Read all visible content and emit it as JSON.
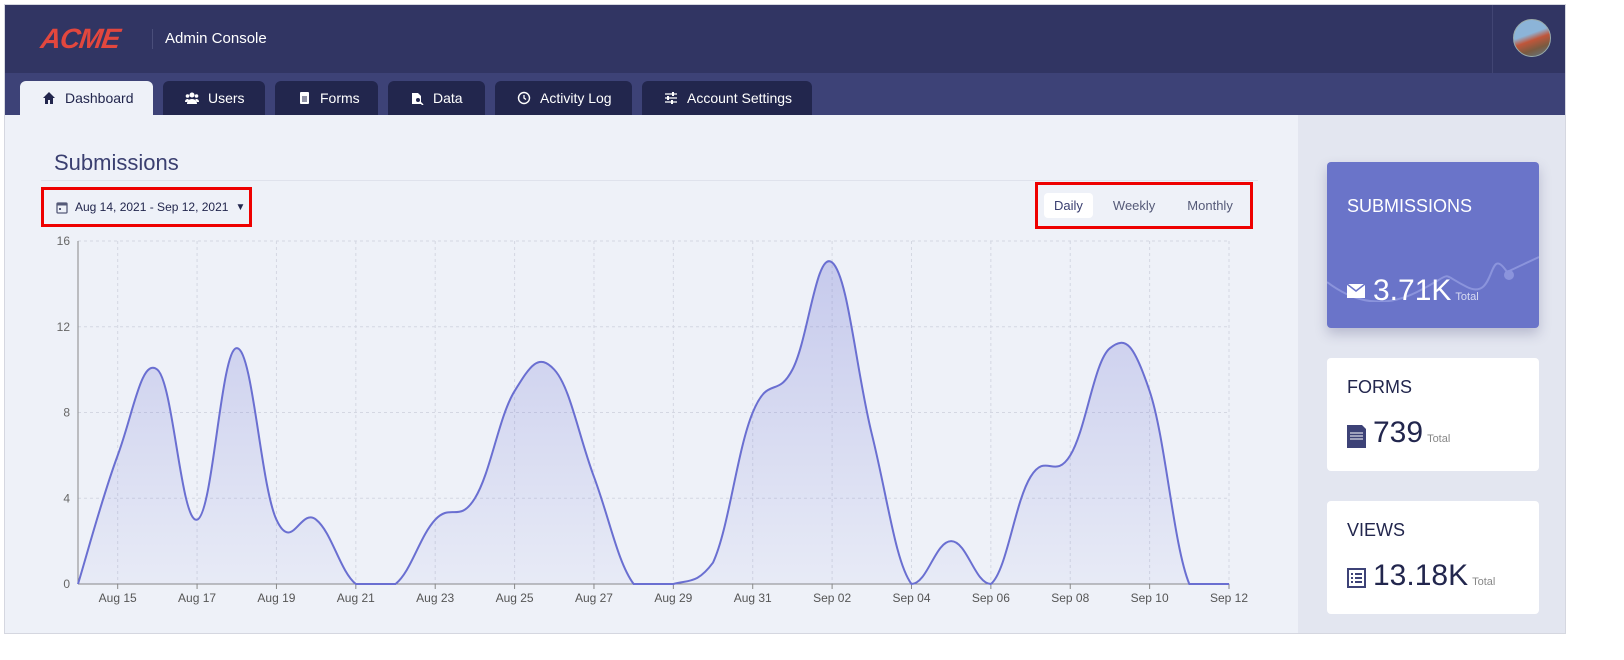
{
  "header": {
    "logo": "ACME",
    "title": "Admin Console"
  },
  "tabs": [
    {
      "label": "Dashboard",
      "icon": "home-icon"
    },
    {
      "label": "Users",
      "icon": "users-icon"
    },
    {
      "label": "Forms",
      "icon": "forms-icon"
    },
    {
      "label": "Data",
      "icon": "data-icon"
    },
    {
      "label": "Activity Log",
      "icon": "history-icon"
    },
    {
      "label": "Account Settings",
      "icon": "sliders-icon"
    }
  ],
  "main": {
    "title": "Submissions",
    "date_range": "Aug 14, 2021 - Sep 12, 2021",
    "periods": [
      "Daily",
      "Weekly",
      "Monthly"
    ],
    "selected_period": "Daily"
  },
  "cards": [
    {
      "title": "SUBMISSIONS",
      "value": "3.71K",
      "suffix": "Total",
      "icon": "envelope-icon"
    },
    {
      "title": "FORMS",
      "value": "739",
      "suffix": "Total",
      "icon": "document-icon"
    },
    {
      "title": "VIEWS",
      "value": "13.18K",
      "suffix": "Total",
      "icon": "list-icon"
    }
  ],
  "colors": {
    "accent": "#6a6fd1",
    "topbar": "#313563",
    "highlight": "#e00000"
  },
  "chart_data": {
    "type": "area",
    "title": "Submissions",
    "x": [
      "Aug 14",
      "Aug 15",
      "Aug 16",
      "Aug 17",
      "Aug 18",
      "Aug 19",
      "Aug 20",
      "Aug 21",
      "Aug 22",
      "Aug 23",
      "Aug 24",
      "Aug 25",
      "Aug 26",
      "Aug 27",
      "Aug 28",
      "Aug 29",
      "Aug 30",
      "Aug 31",
      "Sep 01",
      "Sep 02",
      "Sep 03",
      "Sep 04",
      "Sep 05",
      "Sep 06",
      "Sep 07",
      "Sep 08",
      "Sep 09",
      "Sep 10",
      "Sep 11",
      "Sep 12"
    ],
    "values": [
      0,
      6,
      10,
      3,
      11,
      3,
      3,
      0,
      0,
      3,
      4,
      9,
      10,
      5,
      0,
      0,
      1,
      8,
      10,
      15,
      7,
      0,
      2,
      0,
      5,
      6,
      11,
      9,
      0,
      0
    ],
    "x_tick_labels": [
      "Aug 15",
      "Aug 17",
      "Aug 19",
      "Aug 21",
      "Aug 23",
      "Aug 25",
      "Aug 27",
      "Aug 29",
      "Aug 31",
      "Sep 02",
      "Sep 04",
      "Sep 06",
      "Sep 08",
      "Sep 10",
      "Sep 12"
    ],
    "y_ticks": [
      "0",
      "4",
      "8",
      "12",
      "16"
    ],
    "ylim": [
      0,
      16
    ],
    "grid": true
  }
}
